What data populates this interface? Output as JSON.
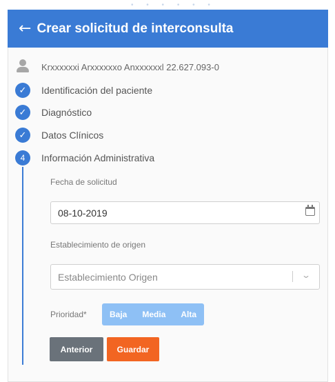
{
  "header": {
    "back_icon": "arrow-left-icon",
    "title": "Crear solicitud de interconsulta"
  },
  "patient": {
    "info": "Krxxxxxxi Arxxxxxxo Anxxxxxxl  22.627.093-0"
  },
  "steps": [
    {
      "label": "Identificación del paciente",
      "status": "done"
    },
    {
      "label": "Diagnóstico",
      "status": "done"
    },
    {
      "label": "Datos Clínicos",
      "status": "done"
    },
    {
      "label": "Información Administrativa",
      "status": "current",
      "number": "4"
    }
  ],
  "form": {
    "fecha_label": "Fecha de solicitud",
    "fecha_value": "08-10-2019",
    "origen_label": "Establecimiento de origen",
    "origen_placeholder": "Establecimiento Origen",
    "prioridad_label": "Prioridad*",
    "prioridad_options": [
      "Baja",
      "Media",
      "Alta"
    ]
  },
  "actions": {
    "prev_label": "Anterior",
    "save_label": "Guardar"
  },
  "colors": {
    "primary": "#3a7bd5",
    "save": "#f26522",
    "prev": "#6a727a",
    "priority": "#8ec0f5"
  }
}
